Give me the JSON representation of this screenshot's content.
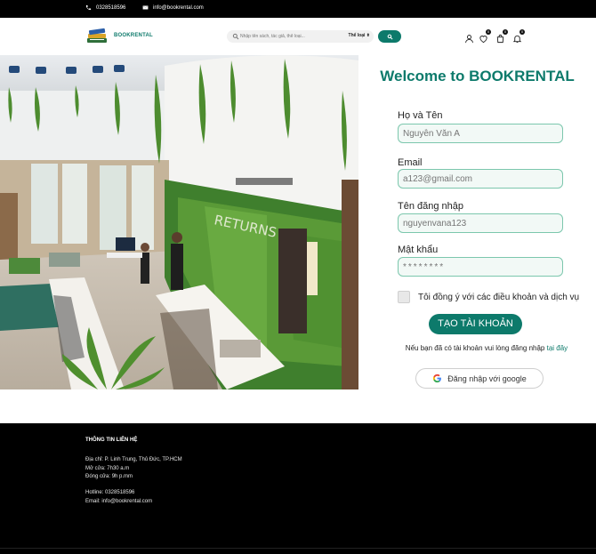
{
  "topbar": {
    "phone": "0328518596",
    "email": "info@bookrental.com"
  },
  "header": {
    "logo_text": "BOOKRENTAL",
    "search_placeholder": "Nhập tên sách, tác giả, thể loại...",
    "category_label": "Thể loại ⬍",
    "badges": {
      "wishlist": "0",
      "cart": "0",
      "notifications": "0"
    }
  },
  "form": {
    "title": "Welcome to BOOKRENTAL",
    "fields": {
      "fullname": {
        "label": "Họ và Tên",
        "placeholder": "Nguyễn Văn A"
      },
      "email": {
        "label": "Email",
        "placeholder": "a123@gmail.com"
      },
      "username": {
        "label": "Tên đăng nhập",
        "placeholder": "nguyenvana123"
      },
      "password": {
        "label": "Mật khẩu",
        "placeholder": "********"
      }
    },
    "terms_label": "Tôi đồng ý với các điều khoản và dịch vụ",
    "submit_label": "TẠO TÀI KHOẢN",
    "login_note": "Nếu bạn đã có tài khoản vui lòng đăng nhập",
    "login_link": "tại đây",
    "google_label": "Đăng nhập với google"
  },
  "footer": {
    "title": "THÔNG TIN LIÊN HỆ",
    "address": "Địa chỉ: P. Linh Trung, Thủ Đức, TP.HCM",
    "open": "Mở cửa: 7h30 a.m",
    "close": "Đóng cửa: 9h p.mm",
    "hotline": "Hotline: 0328518596",
    "email": "Email: info@bookrental.com"
  },
  "colors": {
    "brand": "#0d7a6b",
    "input_border": "#7cc7ad",
    "input_bg": "#f2f9f6"
  }
}
